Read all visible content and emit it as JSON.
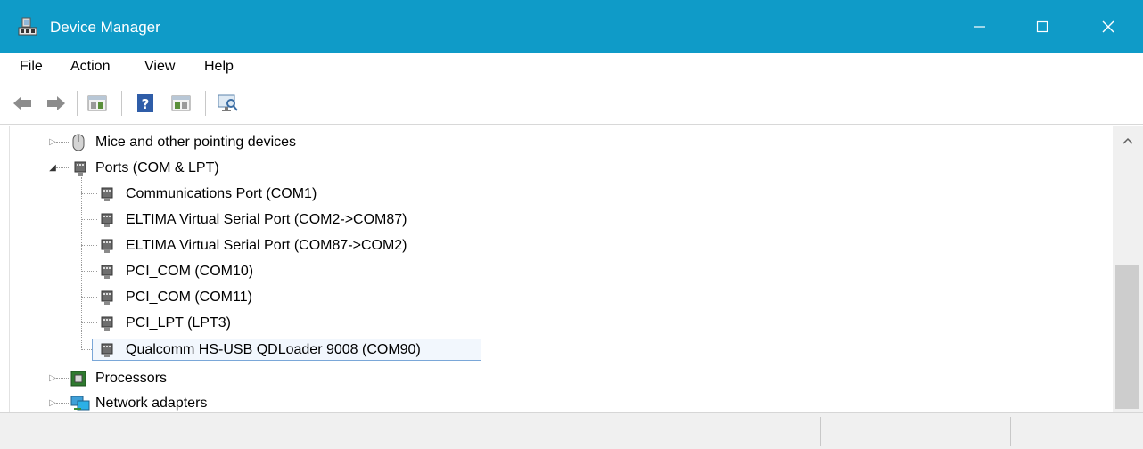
{
  "window": {
    "title": "Device Manager",
    "accent_color": "#0f9bc8",
    "controls": [
      "minimize-icon",
      "maximize-icon",
      "close-icon"
    ]
  },
  "menu": {
    "items": [
      "File",
      "Action",
      "View",
      "Help"
    ]
  },
  "toolbar": {
    "buttons": [
      "back-arrow-icon",
      "forward-arrow-icon",
      "properties-icon",
      "help-icon",
      "update-driver-icon",
      "scan-hardware-icon"
    ]
  },
  "tree": {
    "nodes": [
      {
        "label": "Mice and other pointing devices",
        "icon": "mouse-icon",
        "expanded": false
      },
      {
        "label": "Ports (COM & LPT)",
        "icon": "port-icon",
        "expanded": true,
        "children": [
          {
            "label": "Communications Port (COM1)",
            "icon": "port-icon"
          },
          {
            "label": "ELTIMA Virtual Serial Port (COM2->COM87)",
            "icon": "port-icon"
          },
          {
            "label": "ELTIMA Virtual Serial Port (COM87->COM2)",
            "icon": "port-icon"
          },
          {
            "label": "PCI_COM (COM10)",
            "icon": "port-icon"
          },
          {
            "label": "PCI_COM (COM11)",
            "icon": "port-icon"
          },
          {
            "label": "PCI_LPT (LPT3)",
            "icon": "port-icon"
          },
          {
            "label": "Qualcomm HS-USB QDLoader 9008 (COM90)",
            "icon": "port-icon",
            "selected": true
          }
        ]
      },
      {
        "label": "Processors",
        "icon": "processor-icon",
        "expanded": false
      },
      {
        "label": "Network adapters",
        "icon": "network-adapter-icon",
        "expanded": false
      }
    ]
  },
  "statusbar": {
    "text": ""
  }
}
